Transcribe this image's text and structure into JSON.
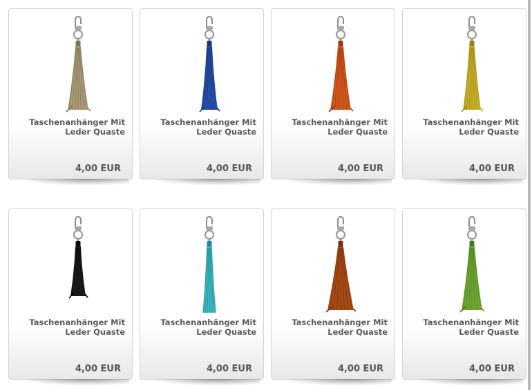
{
  "products": [
    {
      "title": "Taschenanhänger Mit Leder Quaste",
      "price": "4,00 EUR",
      "tassel_color": "#a99a78",
      "tassel_dark": "#7e7256"
    },
    {
      "title": "Taschenanhänger Mit Leder Quaste",
      "price": "4,00 EUR",
      "tassel_color": "#2650a8",
      "tassel_dark": "#183578"
    },
    {
      "title": "Taschenanhänger Mit Leder Quaste",
      "price": "4,00 EUR",
      "tassel_color": "#d2571c",
      "tassel_dark": "#9b3a0f"
    },
    {
      "title": "Taschenanhänger Mit Leder Quaste",
      "price": "4,00 EUR",
      "tassel_color": "#c9b22a",
      "tassel_dark": "#958318"
    },
    {
      "title": "Taschenanhänger Mit Leder Quaste",
      "price": "4,00 EUR",
      "tassel_color": "#1c1c1c",
      "tassel_dark": "#080808"
    },
    {
      "title": "Taschenanhänger Mit Leder Quaste",
      "price": "4,00 EUR",
      "tassel_color": "#3cbcc4",
      "tassel_dark": "#23878e"
    },
    {
      "title": "Taschenanhänger Mit Leder Quaste",
      "price": "4,00 EUR",
      "tassel_color": "#a64a16",
      "tassel_dark": "#73300b"
    },
    {
      "title": "Taschenanhänger Mit Leder Quaste",
      "price": "4,00 EUR",
      "tassel_color": "#6ea832",
      "tassel_dark": "#497820"
    }
  ]
}
